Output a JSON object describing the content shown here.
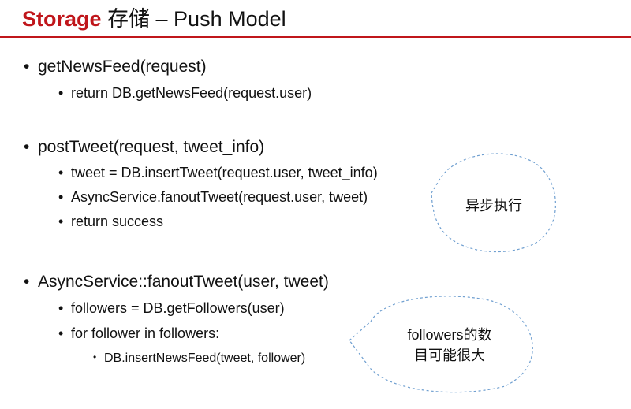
{
  "slide": {
    "title_accent": "Storage",
    "title_rest": " 存储 – Push Model",
    "bullet": "•",
    "items": [
      {
        "text": "getNewsFeed(request)",
        "children": [
          "return DB.getNewsFeed(request.user)"
        ]
      },
      {
        "text": "postTweet(request, tweet_info)",
        "children": [
          "tweet = DB.insertTweet(request.user, tweet_info)",
          "AsyncService.fanoutTweet(request.user, tweet)",
          "return success"
        ]
      },
      {
        "text": "AsyncService::fanoutTweet(user, tweet)",
        "children": [
          "followers = DB.getFollowers(user)",
          "for follower in followers:"
        ],
        "grandchildren": [
          "DB.insertNewsFeed(tweet, follower)"
        ]
      }
    ],
    "callouts": {
      "async": "异步执行",
      "followers_line1": "followers的数",
      "followers_line2": "目可能很大"
    }
  },
  "colors": {
    "accent": "#c0161b",
    "callout_border": "#6f9fd0"
  }
}
